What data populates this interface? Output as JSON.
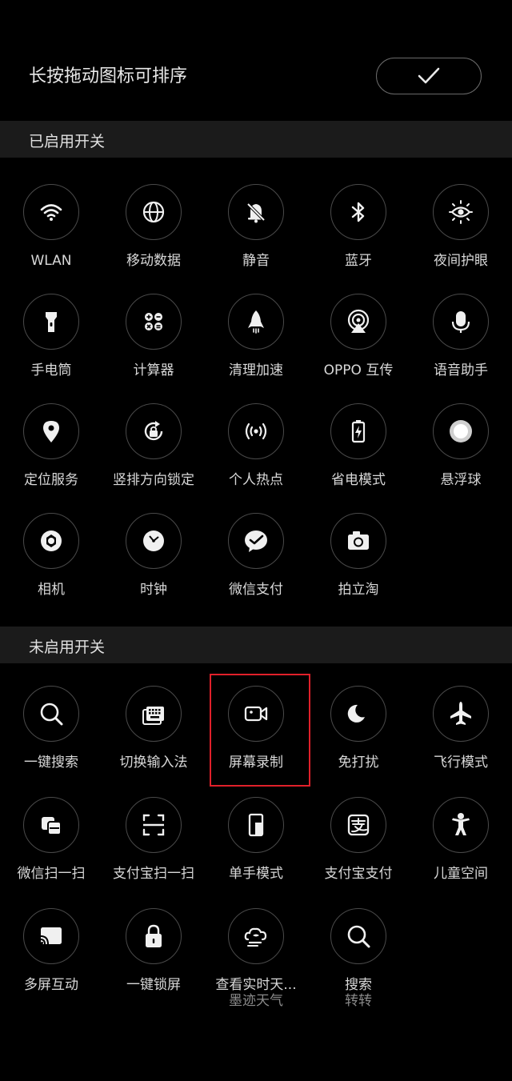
{
  "header": {
    "title": "长按拖动图标可排序",
    "confirm_icon": "checkmark-icon"
  },
  "enabled_section": {
    "label": "已启用开关",
    "items": [
      {
        "label": "WLAN",
        "icon": "wifi-icon"
      },
      {
        "label": "移动数据",
        "icon": "globe-icon"
      },
      {
        "label": "静音",
        "icon": "mute-bell-icon"
      },
      {
        "label": "蓝牙",
        "icon": "bluetooth-icon"
      },
      {
        "label": "夜间护眼",
        "icon": "eye-sun-icon"
      },
      {
        "label": "手电筒",
        "icon": "flashlight-icon"
      },
      {
        "label": "计算器",
        "icon": "calculator-icon"
      },
      {
        "label": "清理加速",
        "icon": "rocket-icon"
      },
      {
        "label": "OPPO 互传",
        "icon": "share-signal-icon"
      },
      {
        "label": "语音助手",
        "icon": "microphone-icon"
      },
      {
        "label": "定位服务",
        "icon": "location-pin-icon"
      },
      {
        "label": "竖排方向锁定",
        "icon": "rotation-lock-icon"
      },
      {
        "label": "个人热点",
        "icon": "hotspot-icon"
      },
      {
        "label": "省电模式",
        "icon": "battery-saver-icon"
      },
      {
        "label": "悬浮球",
        "icon": "floating-ball-icon"
      },
      {
        "label": "相机",
        "icon": "aperture-icon"
      },
      {
        "label": "时钟",
        "icon": "clock-icon"
      },
      {
        "label": "微信支付",
        "icon": "wechat-pay-icon"
      },
      {
        "label": "拍立淘",
        "icon": "camera-icon"
      }
    ]
  },
  "disabled_section": {
    "label": "未启用开关",
    "items": [
      {
        "label": "一键搜索",
        "icon": "search-icon"
      },
      {
        "label": "切换输入法",
        "icon": "keyboard-icon"
      },
      {
        "label": "屏幕录制",
        "icon": "video-camera-icon"
      },
      {
        "label": "免打扰",
        "icon": "moon-icon"
      },
      {
        "label": "飞行模式",
        "icon": "airplane-icon"
      },
      {
        "label": "微信扫一扫",
        "icon": "wechat-scan-icon"
      },
      {
        "label": "支付宝扫一扫",
        "icon": "scan-frame-icon"
      },
      {
        "label": "单手模式",
        "icon": "one-hand-icon"
      },
      {
        "label": "支付宝支付",
        "icon": "alipay-icon"
      },
      {
        "label": "儿童空间",
        "icon": "child-icon"
      },
      {
        "label": "多屏互动",
        "icon": "cast-screen-icon"
      },
      {
        "label": "一键锁屏",
        "icon": "lock-icon"
      },
      {
        "label": "查看实时天...",
        "sub": "墨迹天气",
        "icon": "weather-cloud-icon"
      },
      {
        "label": "搜索",
        "sub": "转转",
        "icon": "search-icon"
      }
    ]
  },
  "colors": {
    "background": "#000000",
    "section_header_bg": "#1b1b1b",
    "highlight": "#e0202a"
  }
}
